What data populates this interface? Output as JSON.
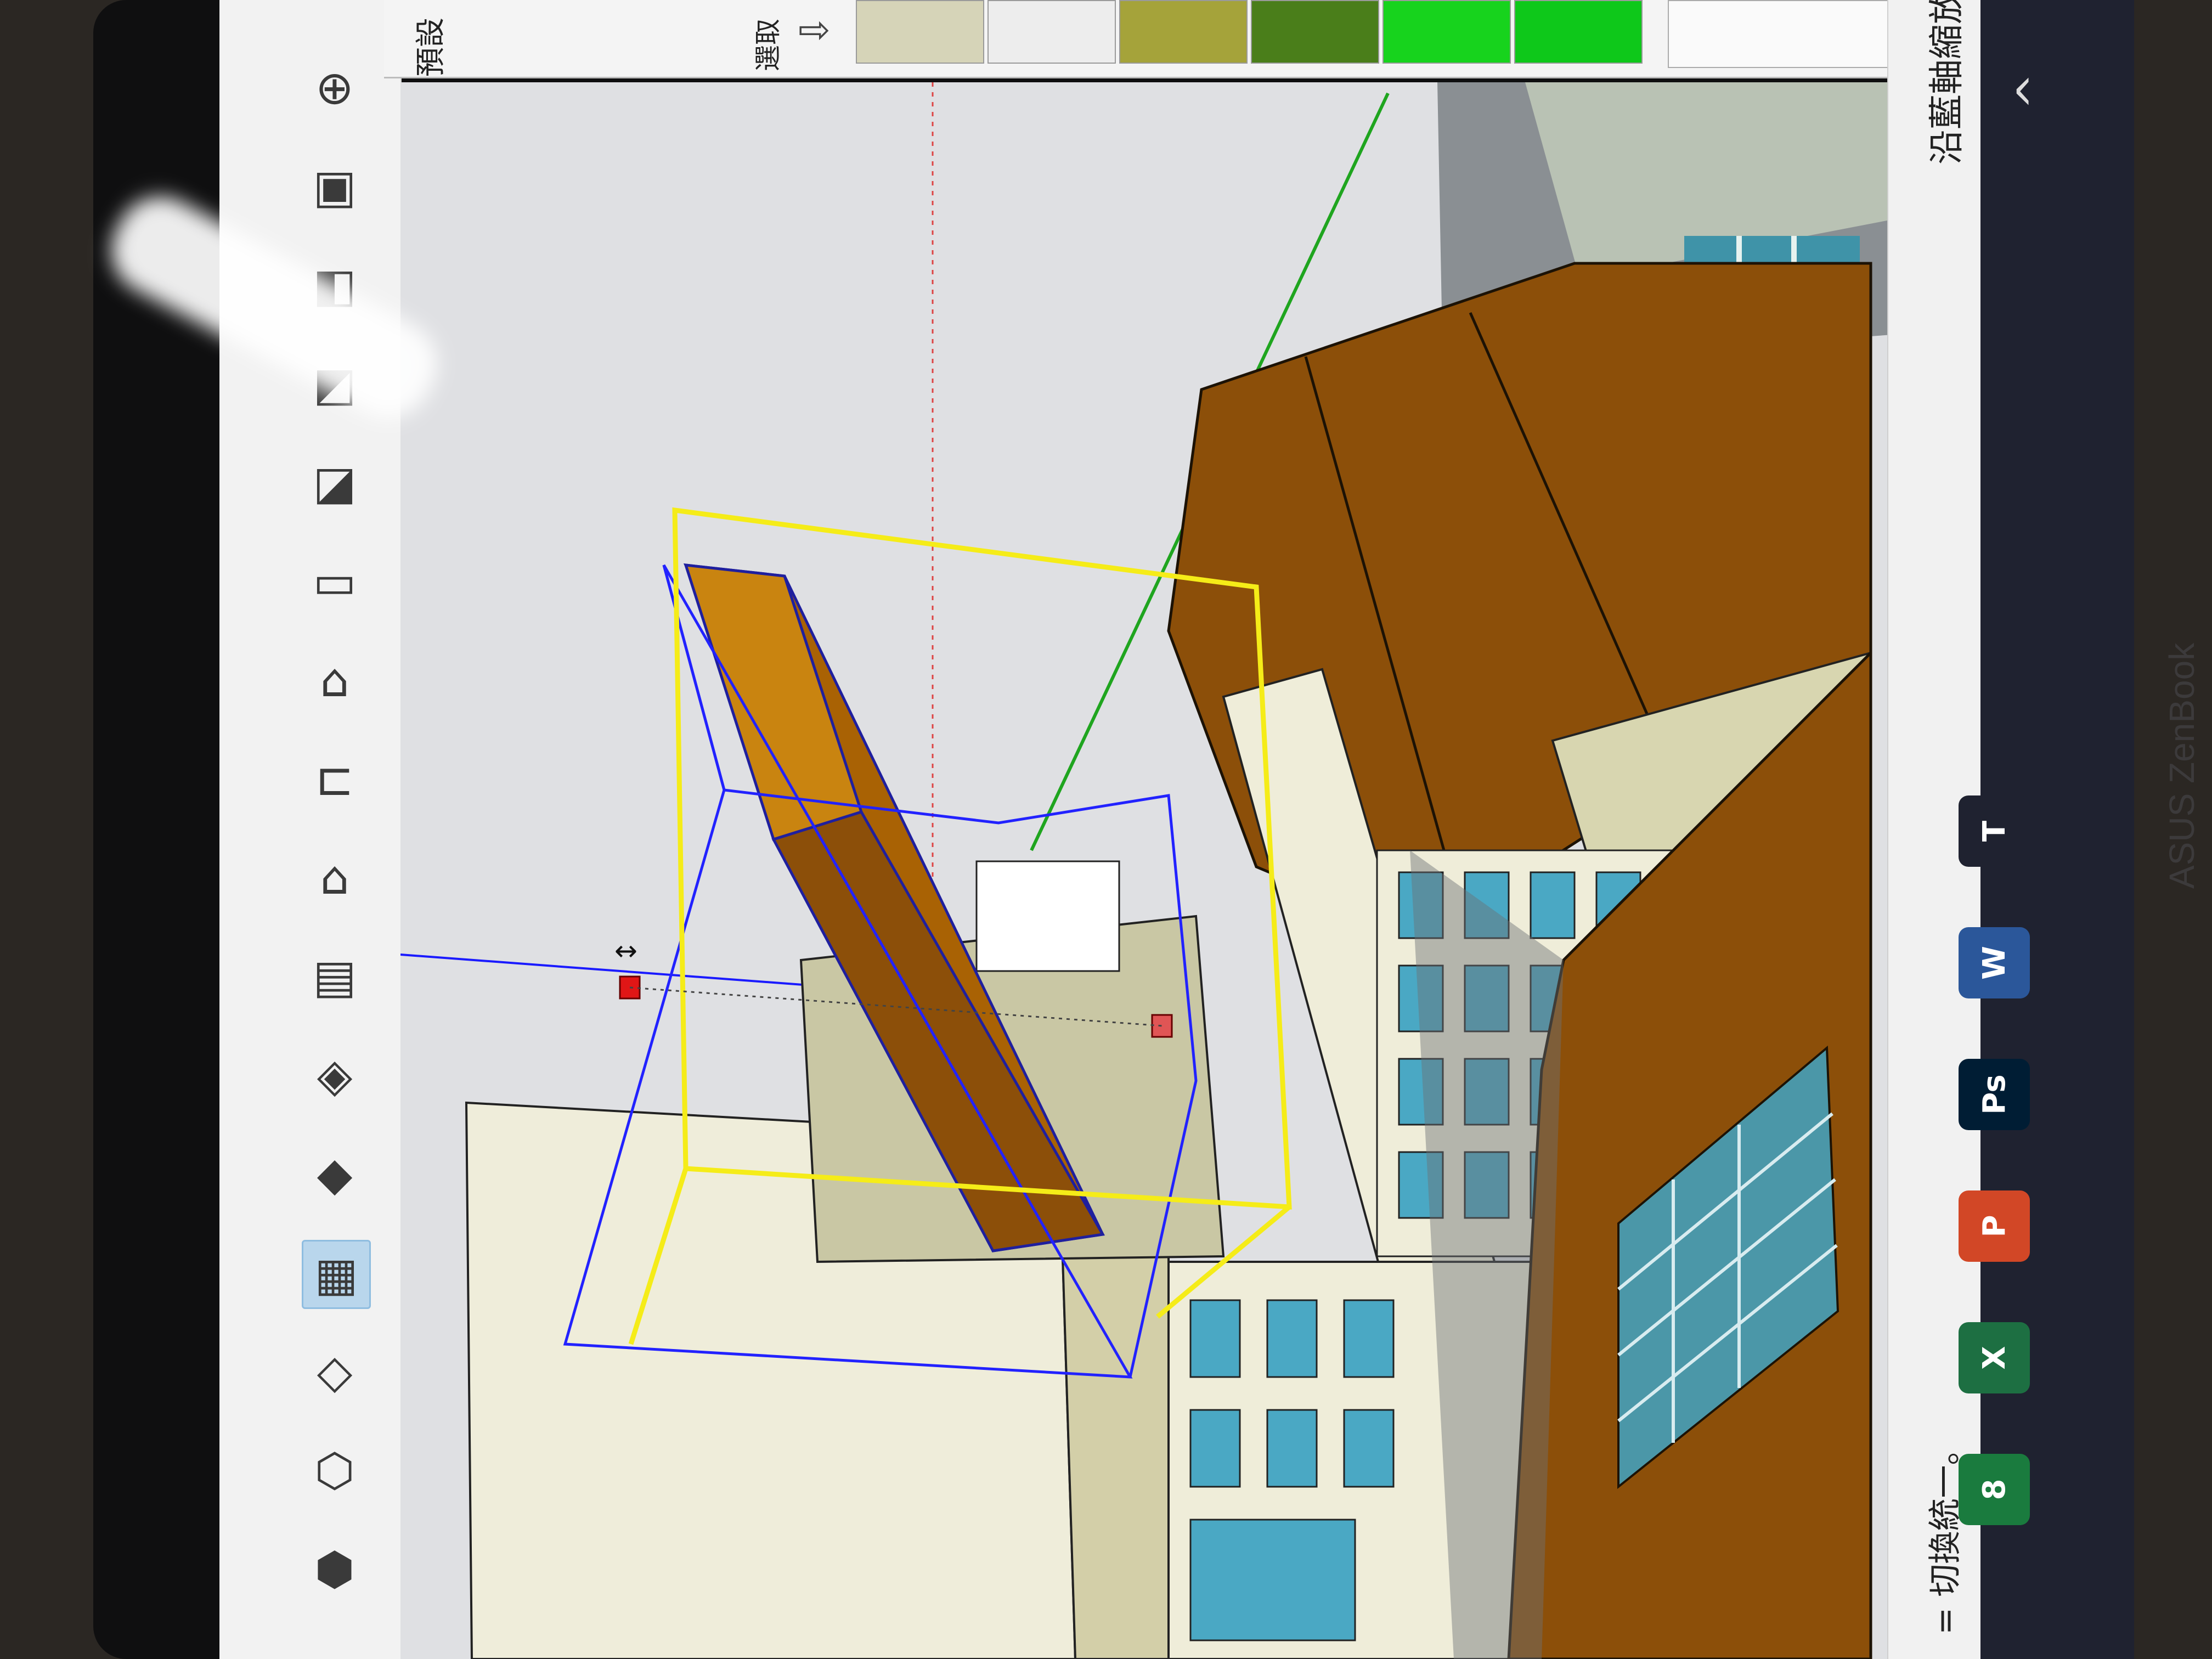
{
  "app": {
    "status_hint": "沿藍軸縮放",
    "bottom_hint": "= 切換統一。",
    "tray_header": "預設",
    "tray_select_label": "選取"
  },
  "tray": {
    "swatch_colors": [
      "#d6d4b8",
      "#ededed",
      "#a5a33a",
      "#4a7e1a",
      "#17d31d",
      "#0ec81a"
    ]
  },
  "toolbar": {
    "tools": [
      {
        "icon": "orbit-icon",
        "glyph": "⊕"
      },
      {
        "icon": "solid-display-icon",
        "glyph": "▣"
      },
      {
        "icon": "shaded-display-icon",
        "glyph": "◧"
      },
      {
        "icon": "xray-display-icon",
        "glyph": "◩"
      },
      {
        "icon": "back-edges-icon",
        "glyph": "◪"
      },
      {
        "icon": "view-top-icon",
        "glyph": "▭"
      },
      {
        "icon": "view-front-icon",
        "glyph": "⌂"
      },
      {
        "icon": "view-right-icon",
        "glyph": "⊏"
      },
      {
        "icon": "view-back-icon",
        "glyph": "⌂"
      },
      {
        "icon": "view-left-icon",
        "glyph": "▤"
      },
      {
        "icon": "iso-view-icon",
        "glyph": "◈"
      },
      {
        "icon": "shaded-textures-icon",
        "glyph": "◆"
      },
      {
        "icon": "monochrome-icon",
        "glyph": "▦"
      },
      {
        "icon": "hidden-line-icon",
        "glyph": "◇"
      },
      {
        "icon": "wireframe-icon",
        "glyph": "⬡"
      },
      {
        "icon": "xray-icon",
        "glyph": "⬢"
      }
    ],
    "active_index": 12
  },
  "taskbar": {
    "apps": [
      {
        "name": "typora",
        "label": "T",
        "color": "#1f2230"
      },
      {
        "name": "word",
        "label": "W",
        "color": "#2b579a"
      },
      {
        "name": "photoshop",
        "label": "Ps",
        "color": "#001d34"
      },
      {
        "name": "powerpoint",
        "label": "P",
        "color": "#d24726"
      },
      {
        "name": "excel",
        "label": "X",
        "color": "#1d6f42"
      },
      {
        "name": "app-8",
        "label": "8",
        "color": "#1a7b3e"
      }
    ],
    "systray_arrow": "^"
  },
  "device": {
    "brand": "ASUS ZenBook"
  }
}
